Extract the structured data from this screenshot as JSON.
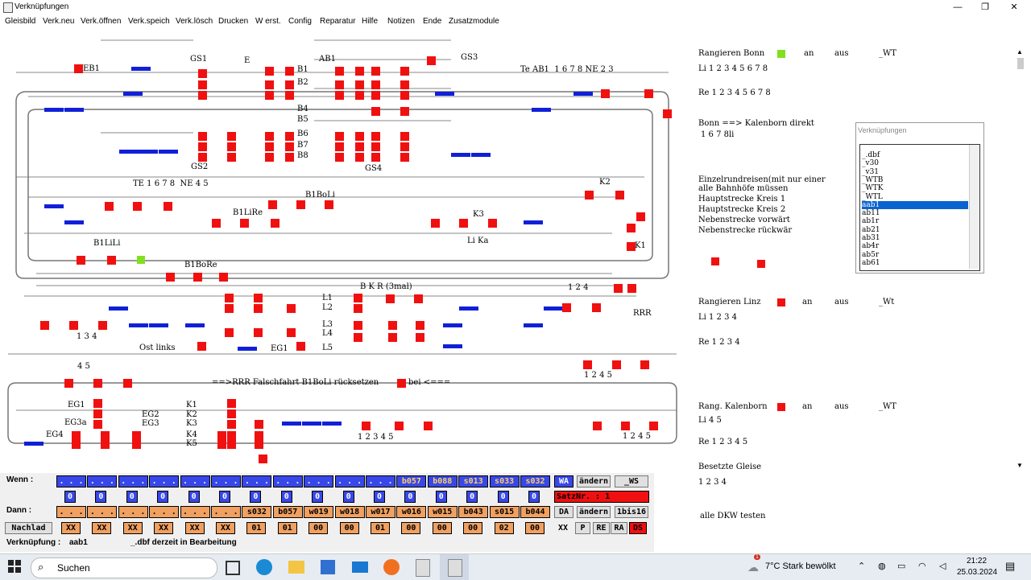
{
  "window": {
    "title": "Verknüpfungen"
  },
  "menu": [
    "Gleisbild",
    "Verk.neu",
    "Verk.öffnen",
    "Verk.speich",
    "Verk.lösch",
    "Drucken",
    "W erst.",
    "Config",
    "Reparatur",
    "Hilfe",
    "Notizen",
    "Ende",
    "Zusatzmodule"
  ],
  "diagram": {
    "labels": [
      "GS1",
      "E",
      "AB1",
      "GS3",
      "EB1",
      "B1",
      "B2",
      "Te AB1  1 6 7 8 NE 2 3",
      "B4",
      "B5",
      "B6",
      "B7",
      "B8",
      "GS2",
      "GS4",
      "TE 1 6 7 8  NE 4 5",
      "B1BoLi",
      "B1LiRe",
      "K3",
      "K2",
      "Li Ka",
      "K1",
      "B1LiLi",
      "B1BoRe",
      "B K R (3mal)",
      "1 2 4",
      "L1",
      "L2",
      "L3",
      "L4",
      "L5",
      "RRR",
      "1 3 4",
      "Ost links",
      "EG1",
      "4 5",
      "1 2 4 5",
      "==>RRR Falschfahrt B1BoLi rücksetzen",
      "bei <===",
      "EG1",
      "EG2",
      "EG3a",
      "EG3",
      "EG4",
      "K1",
      "K2",
      "K3",
      "K4",
      "K5",
      "1 2 3 4 5",
      "1 2 4 5"
    ]
  },
  "right": {
    "lines": [
      "Rangieren Bonn",
      "an",
      "aus",
      "_WT",
      "Li 1 2 3 4 5 6 7 8",
      "Re 1 2 3 4 5 6 7 8",
      "Bonn ==> Kalenborn direkt",
      "1 6 7 8li",
      "Einzelrundreisen(mit nur einer",
      "alle Bahnhöfe müssen",
      "Hauptstrecke Kreis 1",
      "Hauptstrecke Kreis 2",
      "Nebenstrecke vorwärt",
      "Nebenstrecke rückwär",
      "Rangieren Linz",
      "an",
      "aus",
      "_Wt",
      "Li 1 2 3 4",
      "Re 1 2 3 4",
      "Rang. Kalenborn",
      "an",
      "aus",
      "_WT",
      "Li 4 5",
      "Re 1 2 3 4 5",
      "Besetzte Gleise",
      "1 2 3 4",
      "alle DKW testen"
    ]
  },
  "popup": {
    "title": "Verknüpfungen",
    "items": [
      "_.dbf",
      "_v30",
      "_v31",
      "_WTB",
      "_WTK",
      "_WTL",
      "aab1",
      "ab11",
      "ab1r",
      "ab21",
      "ab31",
      "ab4r",
      "ab5r",
      "ab61"
    ],
    "selected": "aab1"
  },
  "bottom": {
    "wenn_label": "Wenn :",
    "dann_label": "Dann :",
    "nachlad_label": "Nachlad",
    "wenn": [
      ". . . .",
      ". . . .",
      ". . . .",
      ". . . .",
      ". . . .",
      ". . . .",
      ". . . .",
      ". . . .",
      ". . . .",
      ". . . .",
      ". . . .",
      "b057",
      "b088",
      "s013",
      "s033",
      "s032"
    ],
    "wenn_flags": [
      "0",
      "0",
      "0",
      "0",
      "0",
      "0",
      "0",
      "0",
      "0",
      "0",
      "0",
      "0",
      "0",
      "0",
      "0",
      "0"
    ],
    "dann": [
      ". . . .",
      ". . . .",
      ". . . .",
      ". . . .",
      ". . . .",
      ". . . .",
      "s032",
      "b057",
      "w019",
      "w018",
      "w017",
      "w016",
      "w015",
      "b043",
      "s015",
      "b044"
    ],
    "nachlad": [
      "XX",
      "XX",
      "XX",
      "XX",
      "XX",
      "XX",
      "01",
      "01",
      "00",
      "00",
      "01",
      "00",
      "00",
      "00",
      "02",
      "00"
    ],
    "wa": "WA",
    "aendern1": "ändern",
    "ws": "_WS",
    "satznr": "SatzNr. : 1",
    "da": "DA",
    "aendern2": "ändern",
    "bis16": "1bis16",
    "xx": "XX",
    "p": "P",
    "re": "RE",
    "ra": "RA",
    "ds": "DS",
    "verkn_label": "Verknüpfung :",
    "verkn_value": "aab1",
    "status": "_.dbf  derzeit in Bearbeitung"
  },
  "taskbar": {
    "search": "Suchen",
    "weather": "7°C  Stark bewölkt",
    "time": "21:22",
    "date": "25.03.2024",
    "badge": "1"
  }
}
